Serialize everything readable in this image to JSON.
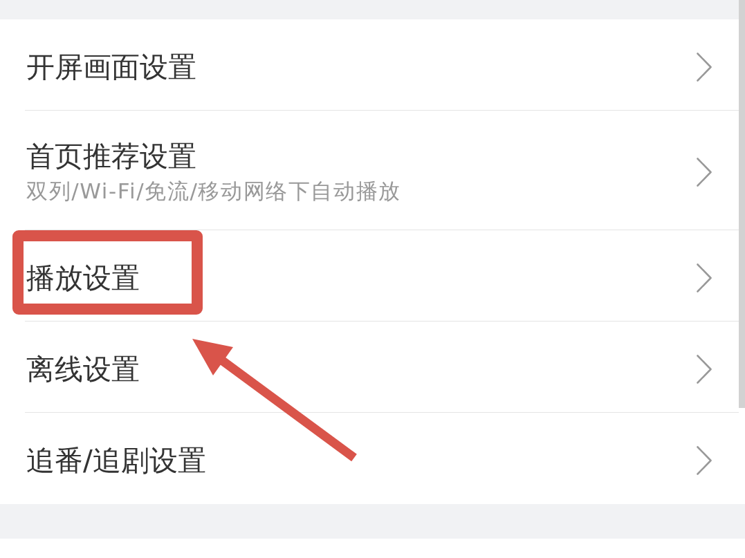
{
  "settings_list": {
    "items": [
      {
        "title": "开屏画面设置",
        "highlighted": false
      },
      {
        "title": "首页推荐设置",
        "subtitle": "双列/Wi-Fi/免流/移动网络下自动播放",
        "highlighted": false
      },
      {
        "title": "播放设置",
        "highlighted": true
      },
      {
        "title": "离线设置",
        "highlighted": false
      },
      {
        "title": "追番/追剧设置",
        "highlighted": false
      }
    ]
  }
}
